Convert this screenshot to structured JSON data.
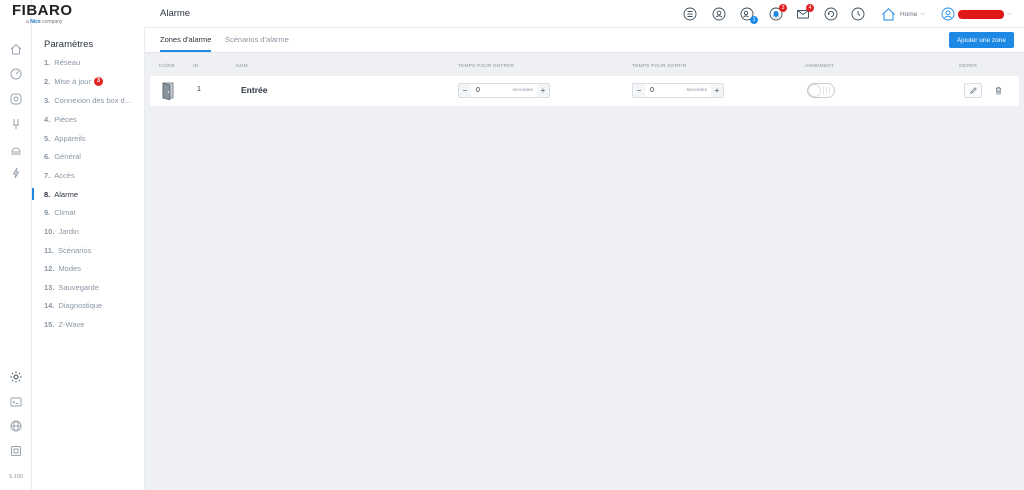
{
  "app": {
    "brand": "FIBARO",
    "brand_sub_prefix": "a",
    "brand_sub_name": "Nice",
    "brand_sub_suffix": "company",
    "version": "5.100"
  },
  "rail_icons": [
    "home-icon",
    "dashboard-icon",
    "target-icon",
    "sensor-icon",
    "monitor-icon",
    "power-icon",
    "settings-icon",
    "terminal-icon",
    "globe-icon",
    "chip-icon"
  ],
  "nav": {
    "title": "Paramètres",
    "items": [
      {
        "num": "1.",
        "label": "Réseau"
      },
      {
        "num": "2.",
        "label": "Mise à jour",
        "badge": "3"
      },
      {
        "num": "3.",
        "label": "Connexion des box d..."
      },
      {
        "num": "4.",
        "label": "Pièces"
      },
      {
        "num": "5.",
        "label": "Appareils"
      },
      {
        "num": "6.",
        "label": "Général"
      },
      {
        "num": "7.",
        "label": "Accès"
      },
      {
        "num": "8.",
        "label": "Alarme",
        "active": true
      },
      {
        "num": "9.",
        "label": "Climat"
      },
      {
        "num": "10.",
        "label": "Jardin"
      },
      {
        "num": "11.",
        "label": "Scénarios"
      },
      {
        "num": "12.",
        "label": "Modes"
      },
      {
        "num": "13.",
        "label": "Sauvegarde"
      },
      {
        "num": "14.",
        "label": "Diagnostique"
      },
      {
        "num": "15.",
        "label": "Z-Wave"
      }
    ]
  },
  "header": {
    "page_title": "Alarme",
    "badges": {
      "devices": "1",
      "bell": "3",
      "mail": "4"
    },
    "home_label": "Home"
  },
  "tabs": [
    {
      "label": "Zones d'alarme",
      "active": true
    },
    {
      "label": "Scénarios d'alarme",
      "active": false
    }
  ],
  "add_zone_label": "Ajouter une zone",
  "table": {
    "headers": {
      "icon": "ICÔNE",
      "id": "ID",
      "name": "NOM",
      "entry": "TEMPS POUR ENTRER",
      "exit": "TEMPS POUR SORTIR",
      "arming": "ARMEMENT",
      "manage": "GÉRER"
    },
    "rows": [
      {
        "id": "1",
        "name": "Entrée",
        "entry_value": "0",
        "entry_unit": "secondes",
        "exit_value": "0",
        "exit_unit": "secondes",
        "armed": false
      }
    ]
  },
  "colors": {
    "accent": "#1e88e5",
    "badge": "#e02424"
  }
}
